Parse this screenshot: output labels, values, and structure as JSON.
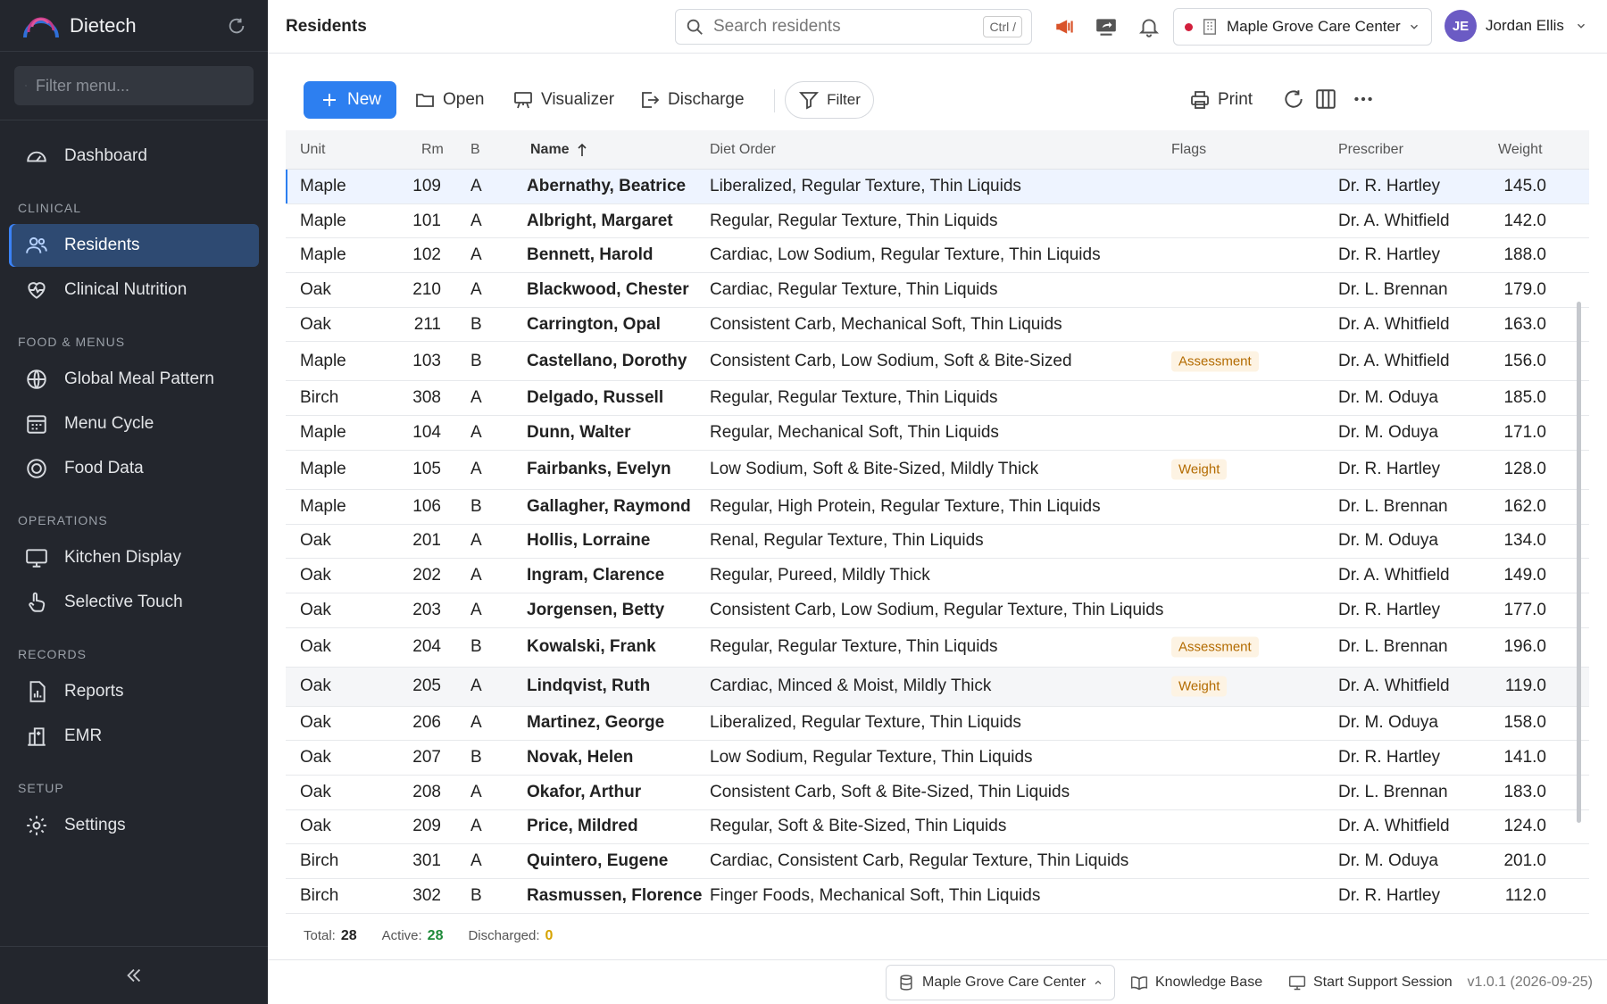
{
  "app": {
    "name": "Dietech"
  },
  "sidebar": {
    "filter_placeholder": "Filter menu...",
    "dashboard": "Dashboard",
    "sections": {
      "clinical": "CLINICAL",
      "food": "FOOD & MENUS",
      "operations": "OPERATIONS",
      "records": "RECORDS",
      "setup": "SETUP"
    },
    "items": {
      "residents": "Residents",
      "clinical_nutrition": "Clinical Nutrition",
      "global_meal_pattern": "Global Meal Pattern",
      "menu_cycle": "Menu Cycle",
      "food_data": "Food Data",
      "kitchen_display": "Kitchen Display",
      "selective_touch": "Selective Touch",
      "reports": "Reports",
      "emr": "EMR",
      "settings": "Settings"
    }
  },
  "header": {
    "title": "Residents",
    "search_placeholder": "Search residents",
    "search_shortcut": "Ctrl /",
    "facility": "Maple Grove Care Center",
    "user_initials": "JE",
    "user_name": "Jordan Ellis"
  },
  "toolbar": {
    "new": "New",
    "open": "Open",
    "visualizer": "Visualizer",
    "discharge": "Discharge",
    "filter": "Filter",
    "print": "Print"
  },
  "table": {
    "columns": {
      "unit": "Unit",
      "rm": "Rm",
      "b": "B",
      "name": "Name",
      "diet": "Diet Order",
      "flags": "Flags",
      "prescriber": "Prescriber",
      "weight": "Weight"
    },
    "rows": [
      [
        "Maple",
        "109",
        "A",
        "Abernathy, Beatrice",
        "Liberalized, Regular Texture, Thin Liquids",
        "",
        "Dr. R. Hartley",
        "145.0"
      ],
      [
        "Maple",
        "101",
        "A",
        "Albright, Margaret",
        "Regular, Regular Texture, Thin Liquids",
        "",
        "Dr. A. Whitfield",
        "142.0"
      ],
      [
        "Maple",
        "102",
        "A",
        "Bennett, Harold",
        "Cardiac, Low Sodium, Regular Texture, Thin Liquids",
        "",
        "Dr. R. Hartley",
        "188.0"
      ],
      [
        "Oak",
        "210",
        "A",
        "Blackwood, Chester",
        "Cardiac, Regular Texture, Thin Liquids",
        "",
        "Dr. L. Brennan",
        "179.0"
      ],
      [
        "Oak",
        "211",
        "B",
        "Carrington, Opal",
        "Consistent Carb, Mechanical Soft, Thin Liquids",
        "",
        "Dr. A. Whitfield",
        "163.0"
      ],
      [
        "Maple",
        "103",
        "B",
        "Castellano, Dorothy",
        "Consistent Carb, Low Sodium, Soft & Bite-Sized",
        "Assessment",
        "Dr. A. Whitfield",
        "156.0"
      ],
      [
        "Birch",
        "308",
        "A",
        "Delgado, Russell",
        "Regular, Regular Texture, Thin Liquids",
        "",
        "Dr. M. Oduya",
        "185.0"
      ],
      [
        "Maple",
        "104",
        "A",
        "Dunn, Walter",
        "Regular, Mechanical Soft, Thin Liquids",
        "",
        "Dr. M. Oduya",
        "171.0"
      ],
      [
        "Maple",
        "105",
        "A",
        "Fairbanks, Evelyn",
        "Low Sodium, Soft & Bite-Sized, Mildly Thick",
        "Weight",
        "Dr. R. Hartley",
        "128.0"
      ],
      [
        "Maple",
        "106",
        "B",
        "Gallagher, Raymond",
        "Regular, High Protein, Regular Texture, Thin Liquids",
        "",
        "Dr. L. Brennan",
        "162.0"
      ],
      [
        "Oak",
        "201",
        "A",
        "Hollis, Lorraine",
        "Renal, Regular Texture, Thin Liquids",
        "",
        "Dr. M. Oduya",
        "134.0"
      ],
      [
        "Oak",
        "202",
        "A",
        "Ingram, Clarence",
        "Regular, Pureed, Mildly Thick",
        "",
        "Dr. A. Whitfield",
        "149.0"
      ],
      [
        "Oak",
        "203",
        "A",
        "Jorgensen, Betty",
        "Consistent Carb, Low Sodium, Regular Texture, Thin Liquids",
        "",
        "Dr. R. Hartley",
        "177.0"
      ],
      [
        "Oak",
        "204",
        "B",
        "Kowalski, Frank",
        "Regular, Regular Texture, Thin Liquids",
        "Assessment",
        "Dr. L. Brennan",
        "196.0"
      ],
      [
        "Oak",
        "205",
        "A",
        "Lindqvist, Ruth",
        "Cardiac, Minced & Moist, Mildly Thick",
        "Weight",
        "Dr. A. Whitfield",
        "119.0"
      ],
      [
        "Oak",
        "206",
        "A",
        "Martinez, George",
        "Liberalized, Regular Texture, Thin Liquids",
        "",
        "Dr. M. Oduya",
        "158.0"
      ],
      [
        "Oak",
        "207",
        "B",
        "Novak, Helen",
        "Low Sodium, Regular Texture, Thin Liquids",
        "",
        "Dr. R. Hartley",
        "141.0"
      ],
      [
        "Oak",
        "208",
        "A",
        "Okafor, Arthur",
        "Consistent Carb, Soft & Bite-Sized, Thin Liquids",
        "",
        "Dr. L. Brennan",
        "183.0"
      ],
      [
        "Oak",
        "209",
        "A",
        "Price, Mildred",
        "Regular, Soft & Bite-Sized, Thin Liquids",
        "",
        "Dr. A. Whitfield",
        "124.0"
      ],
      [
        "Birch",
        "301",
        "A",
        "Quintero, Eugene",
        "Cardiac, Consistent Carb, Regular Texture, Thin Liquids",
        "",
        "Dr. M. Oduya",
        "201.0"
      ],
      [
        "Birch",
        "302",
        "B",
        "Rasmussen, Florence",
        "Finger Foods, Mechanical Soft, Thin Liquids",
        "",
        "Dr. R. Hartley",
        "112.0"
      ]
    ]
  },
  "totals": {
    "total_label": "Total:",
    "total": "28",
    "active_label": "Active:",
    "active": "28",
    "discharged_label": "Discharged:",
    "discharged": "0"
  },
  "footer": {
    "facility": "Maple Grove Care Center",
    "knowledge_base": "Knowledge Base",
    "support": "Start Support Session",
    "version": "v1.0.1 (2026-09-25)"
  }
}
